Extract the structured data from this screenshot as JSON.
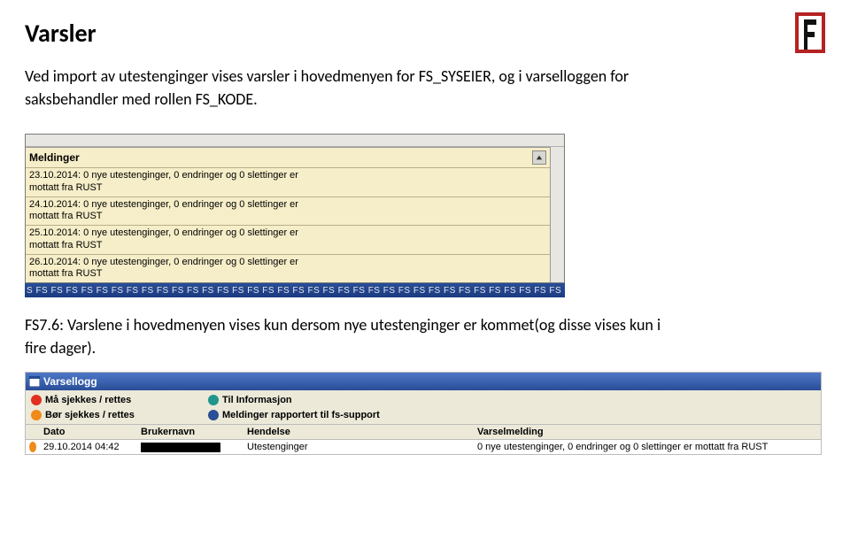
{
  "title": "Varsler",
  "paragraph1": "Ved import av utestenginger vises varsler i hovedmenyen for FS_SYSEIER, og i varselloggen for saksbehandler med rollen FS_KODE.",
  "paragraph2": "FS7.6: Varslene i hovedmenyen vises kun dersom nye utestenginger er kommet(og disse vises kun i fire dager).",
  "meldinger": {
    "header": "Meldinger",
    "item1line1": "23.10.2014: 0 nye utestenginger, 0 endringer og 0 slettinger er",
    "item1line2": "mottatt fra RUST",
    "item2line1": "24.10.2014: 0 nye utestenginger, 0 endringer og 0 slettinger er",
    "item2line2": "mottatt fra RUST",
    "item3line1": "25.10.2014: 0 nye utestenginger, 0 endringer og 0 slettinger er",
    "item3line2": "mottatt fra RUST",
    "item4line1": "26.10.2014: 0 nye utestenginger, 0 endringer og 0 slettinger er",
    "item4line2": "mottatt fra RUST"
  },
  "fs_strip": "S FS FS FS FS FS FS FS FS FS FS FS FS FS FS FS FS FS FS FS FS FS FS FS FS FS FS FS FS FS FS FS FS FS FS FS FS FS",
  "varsellogg": {
    "title": "Varsellogg",
    "legend": {
      "red": "Må sjekkes / rettes",
      "teal": "Til Informasjon",
      "orange": "Bør sjekkes / rettes",
      "blue": "Meldinger rapportert til fs-support"
    },
    "columns": {
      "dato": "Dato",
      "brukernavn": "Brukernavn",
      "hendelse": "Hendelse",
      "varselmelding": "Varselmelding"
    },
    "row": {
      "dato": "29.10.2014 04:42",
      "hendelse": "Utestenginger",
      "varselmelding": "0 nye utestenginger, 0 endringer og 0 slettinger er mottatt fra RUST"
    }
  }
}
